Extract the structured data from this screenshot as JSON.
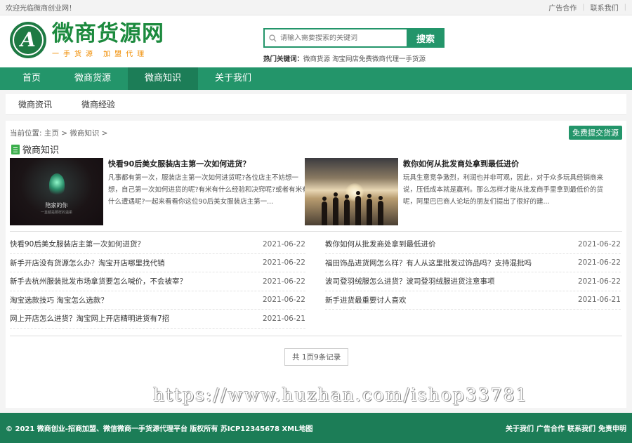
{
  "topbar": {
    "welcome": "欢迎光临微商创业网！",
    "ad": "广告合作",
    "contact": "联系我们"
  },
  "logo": {
    "letter": "A",
    "name": "微商货源网",
    "slogan": "一手货源 加盟代理"
  },
  "search": {
    "placeholder": "请输入需要搜索的关键词",
    "button": "搜索",
    "hot_label": "热门关键词：",
    "hot_words": "微商货源 淘宝网店免费微商代理一手货源"
  },
  "nav": [
    "首页",
    "微商货源",
    "微商知识",
    "关于我们"
  ],
  "subnav": [
    "微商资讯",
    "微商经验"
  ],
  "breadcrumb": "当前位置: 主页 > 微商知识 >",
  "submit_button": "免费提交货源",
  "section_title": "微商知识",
  "featured": [
    {
      "title": "快看90后美女服装店主第一次如何进货？",
      "desc": "凡事都有第一次，服装店主第一次如何进货呢?各位店主不妨想一想，自己第一次如何进货的呢?有米有什么经验和决窍呢?或者有米有什么遭遇呢?一起来看看你这位90后美女服装店主第一...",
      "image_caption": "陪家的你",
      "image_subcaption": "一直都是那样的温柔"
    },
    {
      "title": "教你如何从批发商处拿到最低进价",
      "desc": "玩具生意竞争激烈，利润也并非可观，因此，对于众多玩具经销商来说，压低成本就是赢利。那么怎样才能从批发商手里拿到最低价的货呢，阿里巴巴商人论坛的朋友们提出了很好的建..."
    }
  ],
  "list_left": [
    {
      "title": "快看90后美女服装店主第一次如何进货？",
      "date": "2021-06-22"
    },
    {
      "title": "新手开店没有货源怎么办？淘宝开店哪里找代销",
      "date": "2021-06-22"
    },
    {
      "title": "新手去杭州服装批发市场拿货要怎么喊价，不会被宰？",
      "date": "2021-06-22"
    },
    {
      "title": "淘宝选款技巧 淘宝怎么选款？",
      "date": "2021-06-22"
    },
    {
      "title": "网上开店怎么进货？淘宝网上开店精明进货有7招",
      "date": "2021-06-21"
    }
  ],
  "list_right": [
    {
      "title": "教你如何从批发商处拿到最低进价",
      "date": "2021-06-22"
    },
    {
      "title": "福田饰品进货网怎么样？有人从这里批发过饰品吗？支持混批吗",
      "date": "2021-06-22"
    },
    {
      "title": "波司登羽绒服怎么进货？波司登羽绒服进货注意事项",
      "date": "2021-06-22"
    },
    {
      "title": "新手进货最重要讨人喜欢",
      "date": "2021-06-21"
    }
  ],
  "pager": "共 1页9条记录",
  "watermark": "https://www.huzhan.com/ishop33781",
  "footer": {
    "copyright": "© 2021 微商创业-招商加盟、微信微商一手货源代理平台 版权所有 苏ICP12345678 XML地图",
    "links": [
      "关于我们",
      "广告合作",
      "联系我们",
      "免责申明"
    ]
  },
  "colors": {
    "brand_green": "#23956a",
    "nav_active": "#1c7d57",
    "logo_green": "#1c8a3e",
    "slogan_orange": "#f08c00"
  }
}
